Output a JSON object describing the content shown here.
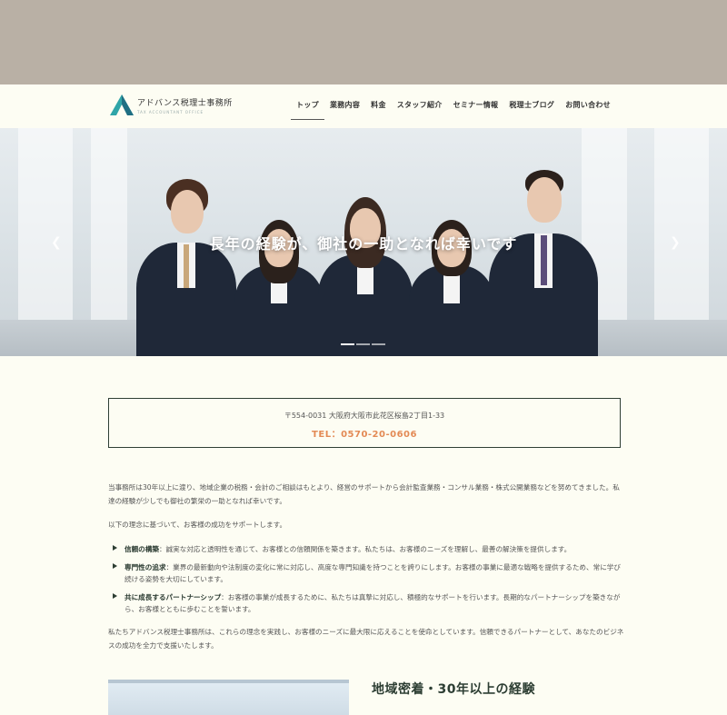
{
  "header": {
    "logo_name": "アドバンス税理士事務所",
    "logo_sub": "TAX ACCOUNTANT OFFICE",
    "nav": [
      {
        "label": "トップ"
      },
      {
        "label": "業務内容"
      },
      {
        "label": "料金"
      },
      {
        "label": "スタッフ紹介"
      },
      {
        "label": "セミナー情報"
      },
      {
        "label": "税理士ブログ"
      },
      {
        "label": "お問い合わせ"
      }
    ]
  },
  "hero": {
    "caption": "長年の経験が、御社の一助となれば幸いです",
    "prev_icon": "chevron-left-icon",
    "next_icon": "chevron-right-icon",
    "slide_count": 3,
    "active_slide": 1
  },
  "contact": {
    "address": "〒554-0031 大阪府大阪市此花区桜島2丁目1-33",
    "tel": "TEL：0570-20-0606"
  },
  "intro": {
    "p1": "当事務所は30年以上に渡り、地域企業の税務・会計のご相談はもとより、経営のサポートから会計監査業務・コンサル業務・株式公開業務などを努めてきました。私達の経験が少しでも御社の繁栄の一助となれば幸いです。",
    "p2": "以下の理念に基づいて、お客様の成功をサポートします。",
    "bullets": [
      {
        "title": "信頼の構築",
        "text": "：誠実な対応と透明性を通じて、お客様との信頼関係を築きます。私たちは、お客様のニーズを理解し、最善の解決策を提供します。"
      },
      {
        "title": "専門性の追求",
        "text": "：業界の最新動向や法制度の変化に常に対応し、高度な専門知識を持つことを誇りにします。お客様の事業に最適な戦略を提供するため、常に学び続ける姿勢を大切にしています。"
      },
      {
        "title": "共に成長するパートナーシップ",
        "text": "：お客様の事業が成長するために、私たちは真摯に対応し、積極的なサポートを行います。長期的なパートナーシップを築きながら、お客様とともに歩むことを誓います。"
      }
    ],
    "p3": "私たちアドバンス税理士事務所は、これらの理念を実践し、お客様のニーズに最大限に応えることを使命としています。信頼できるパートナーとして、あなたのビジネスの成功を全力で支援いたします。"
  },
  "feature": {
    "title": "地域密着・30年以上の経験"
  },
  "colors": {
    "accent_green": "#2d3e33",
    "tel_orange": "#e38a55",
    "background": "#fdfdf3",
    "top_band": "#b9b0a5"
  }
}
